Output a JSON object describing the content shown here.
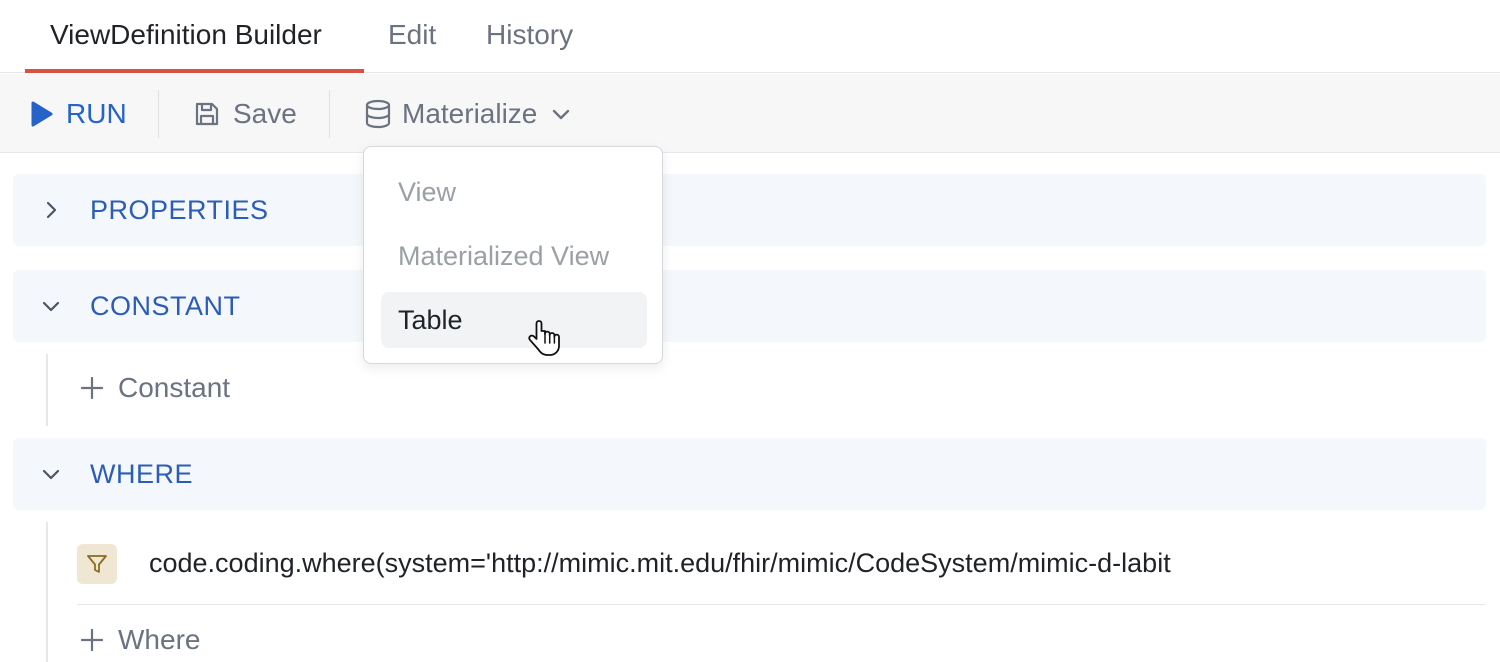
{
  "tabs": [
    {
      "label": "ViewDefinition Builder",
      "active": true
    },
    {
      "label": "Edit",
      "active": false
    },
    {
      "label": "History",
      "active": false
    }
  ],
  "toolbar": {
    "run_label": "RUN",
    "save_label": "Save",
    "materialize_label": "Materialize"
  },
  "materialize_menu": {
    "items": [
      "View",
      "Materialized View",
      "Table"
    ],
    "hovered": "Table"
  },
  "sections": {
    "properties": {
      "title": "PROPERTIES",
      "expanded": false
    },
    "constant": {
      "title": "CONSTANT",
      "expanded": true,
      "add_label": "Constant"
    },
    "where": {
      "title": "WHERE",
      "expanded": true,
      "expressions": [
        "code.coding.where(system='http://mimic.mit.edu/fhir/mimic/CodeSystem/mimic-d-labit"
      ],
      "add_label": "Where"
    }
  },
  "icons": [
    "play-icon",
    "save-icon",
    "database-icon",
    "chevron-down-icon",
    "chevron-right-icon",
    "plus-icon",
    "filter-icon",
    "hand-cursor-icon"
  ],
  "colors": {
    "accent_blue": "#2563c9",
    "section_title": "#2b5db8",
    "active_tab_underline": "#d9523f",
    "filter_badge_bg": "#efe7d3"
  }
}
